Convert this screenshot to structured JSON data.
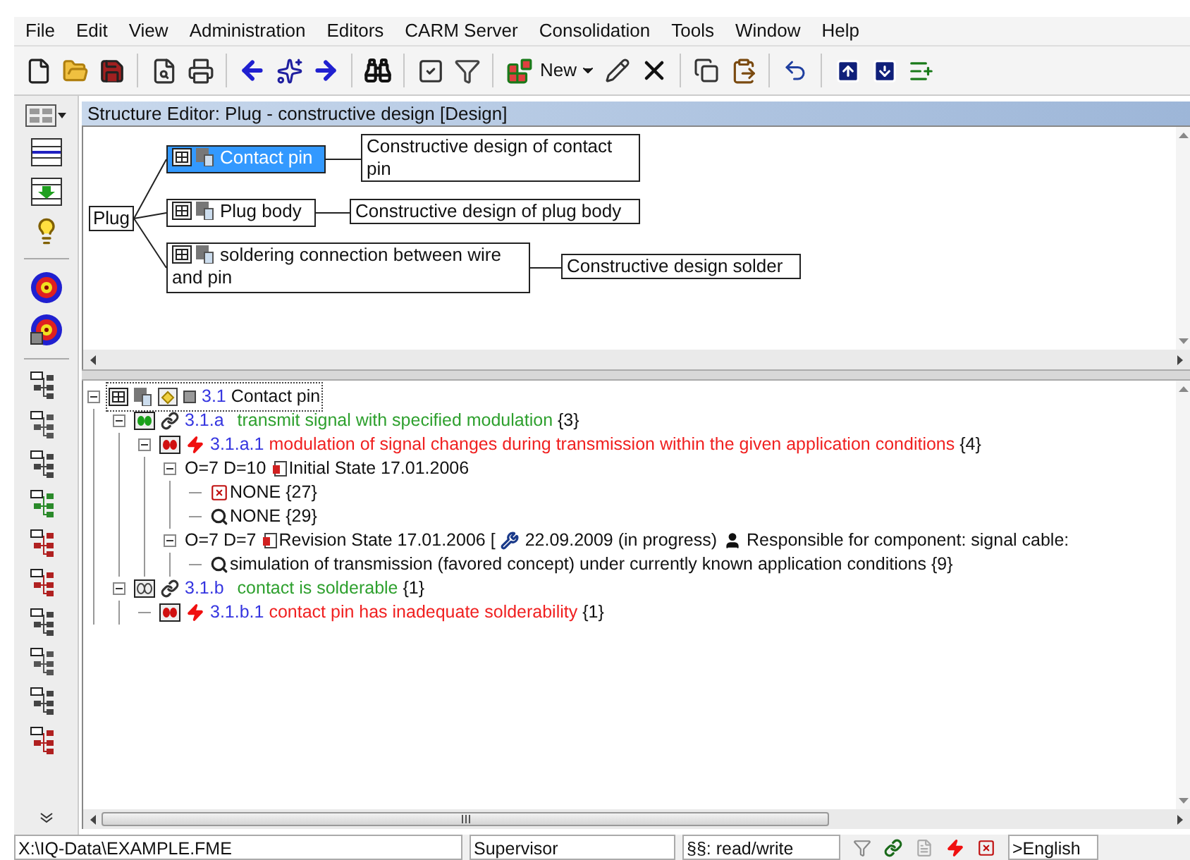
{
  "menu": [
    {
      "label": "File"
    },
    {
      "label": "Edit"
    },
    {
      "label": "View"
    },
    {
      "label": "Administration"
    },
    {
      "label": "Editors"
    },
    {
      "label": "CARM Server"
    },
    {
      "label": "Consolidation"
    },
    {
      "label": "Tools"
    },
    {
      "label": "Window"
    },
    {
      "label": "Help"
    }
  ],
  "toolbar": {
    "new_label": "New"
  },
  "editor": {
    "title": "Structure Editor: Plug - constructive design [Design]"
  },
  "diagram": {
    "root": "Plug",
    "nodes": [
      {
        "label": "Contact pin",
        "description": "Constructive design of contact pin",
        "selected": true
      },
      {
        "label": "Plug body",
        "description": "Constructive design of plug body",
        "selected": false
      },
      {
        "label": "soldering connection between wire and pin",
        "description": "Constructive design solder",
        "selected": false
      }
    ]
  },
  "tree": [
    {
      "kind": "component",
      "number": "3.1",
      "text": "Contact pin",
      "selected": true,
      "expanded": true,
      "children": [
        {
          "kind": "function",
          "number": "3.1.a",
          "text": "transmit signal with specified modulation",
          "count": "{3}",
          "covered": true,
          "selected": false,
          "expanded": true,
          "children": [
            {
              "kind": "failure",
              "number": "3.1.a.1",
              "text": "modulation of signal changes during transmission within the given application conditions",
              "count": "{4}",
              "selected": false,
              "expanded": true,
              "children": [
                {
                  "kind": "state",
                  "rating": "O=7 D=10",
                  "text": "Initial State 17.01.2006",
                  "selected": false,
                  "expanded": true,
                  "children": [
                    {
                      "kind": "prevention",
                      "text": "NONE",
                      "count": "{27}",
                      "selected": false
                    },
                    {
                      "kind": "detection",
                      "text": "NONE",
                      "count": "{29}",
                      "selected": false
                    }
                  ]
                },
                {
                  "kind": "state",
                  "rating": "O=7 D=7",
                  "text": "Revision State 17.01.2006 [",
                  "extras": [
                    {
                      "kind": "date",
                      "text": "22.09.2009 (in progress)"
                    },
                    {
                      "kind": "responsible",
                      "text": "Responsible for component: signal cable:"
                    }
                  ],
                  "selected": false,
                  "expanded": true,
                  "children": [
                    {
                      "kind": "detection",
                      "text": "simulation of transmission (favored concept) under currently known application conditions",
                      "count": "{9}",
                      "selected": false
                    }
                  ]
                }
              ]
            }
          ]
        },
        {
          "kind": "function",
          "number": "3.1.b",
          "text": "contact is solderable",
          "count": "{1}",
          "covered": false,
          "selected": false,
          "expanded": true,
          "children": [
            {
              "kind": "failure",
              "number": "3.1.b.1",
              "text": "contact pin has inadequate solderability",
              "count": "{1}",
              "selected": false
            }
          ]
        }
      ]
    }
  ],
  "status_bar": {
    "file": "X:\\IQ-Data\\EXAMPLE.FME",
    "user": "Supervisor",
    "rights": "§§: read/write",
    "language": ">English"
  }
}
